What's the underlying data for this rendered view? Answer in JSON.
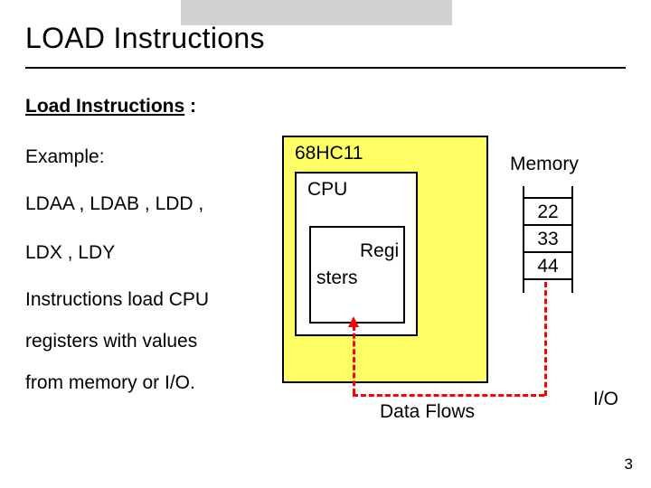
{
  "title": "LOAD Instructions",
  "subheading_ul": "Load Instructions",
  "subheading_tail": " :",
  "lines": {
    "example": "Example:",
    "ldaa": "LDAA ,  LDAB ,  LDD ,",
    "ldx": "LDX ,  LDY",
    "instr": "Instructions load  CPU",
    "reg": "registers with values",
    "mem": "from memory or I/O."
  },
  "diagram": {
    "hc11": "68HC11",
    "cpu": "CPU",
    "reg_line1": "Regi",
    "reg_line2": "sters",
    "memory_label": "Memory",
    "memory_cells": [
      "22",
      "33",
      "44"
    ],
    "dataflows": "Data Flows",
    "io": "I/O"
  },
  "page_number": "3"
}
